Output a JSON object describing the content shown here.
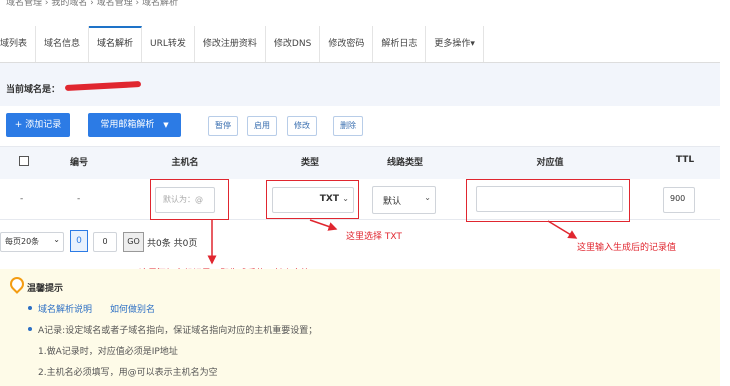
{
  "breadcrumb": "域名管理 › 我的域名 › 域名管理 › 域名解析",
  "tabs": [
    "域列表",
    "域名信息",
    "域名解析",
    "URL转发",
    "修改注册资料",
    "修改DNS",
    "修改密码",
    "解析日志",
    "更多操作▾"
  ],
  "active_tab": 2,
  "domain_label": "当前域名是：",
  "toolbar": {
    "add_record": "+ 添加记录",
    "common_mail": "常用邮箱解析",
    "pause": "暂停",
    "enable": "启用",
    "modify": "修改",
    "delete": "删除"
  },
  "table": {
    "headers": [
      "编号",
      "主机名",
      "类型",
      "线路类型",
      "对应值",
      "TTL"
    ],
    "row": {
      "dash1": "-",
      "dash2": "-",
      "host_placeholder": "默认为：@",
      "type_value": "TXT",
      "line_value": "默认",
      "value_value": "",
      "ttl_value": "900"
    }
  },
  "pager": {
    "page_size": "每页20条",
    "current": "0",
    "page_input": "0",
    "go": "GO",
    "summary": "共0条 共0页"
  },
  "annotations": {
    "type_hint": "这里选择 TXT",
    "value_hint": "这里输入生成后的记录值",
    "host_hint": "这里添加主机记录，即生成后的一长串字符"
  },
  "tips": {
    "title": "温馨提示",
    "link1": "域名解析说明",
    "link2": "如何做别名",
    "line1": "A记录:设定域名或者子域名指向，保证域名指向对应的主机重要设置；",
    "line2": "1.做A记录时，对应值必须是IP地址",
    "line3": "2.主机名必须填写，用@可以表示主机名为空"
  },
  "colors": {
    "accent": "#2c7be5",
    "annotation": "#e0262f",
    "tip_bg": "#fefbe8"
  }
}
